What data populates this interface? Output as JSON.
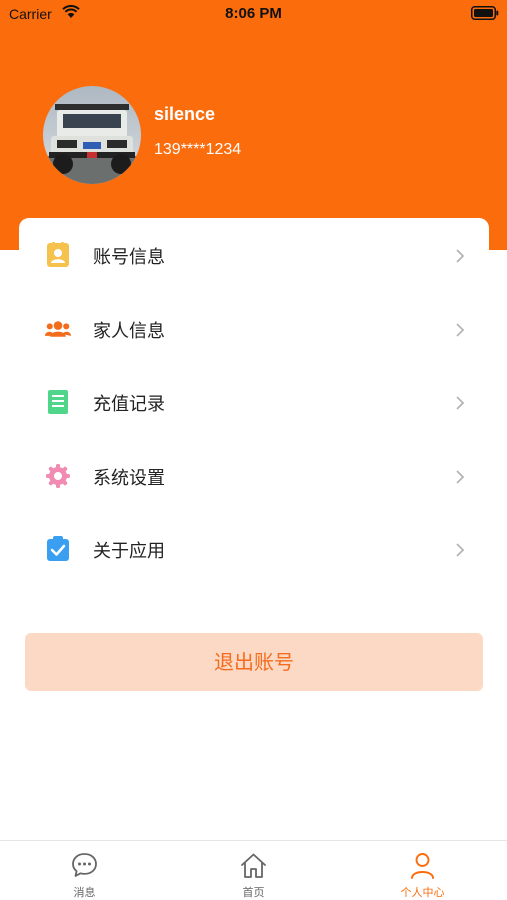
{
  "status_bar": {
    "carrier": "Carrier",
    "time": "8:06 PM"
  },
  "profile": {
    "name": "silence",
    "phone": "139****1234"
  },
  "menu": {
    "items": [
      {
        "label": "账号信息",
        "icon": "id-card-icon",
        "color": "#f4c24d"
      },
      {
        "label": "家人信息",
        "icon": "users-group-icon",
        "color": "#f36c1c"
      },
      {
        "label": "充值记录",
        "icon": "receipt-icon",
        "color": "#4fd68b"
      },
      {
        "label": "系统设置",
        "icon": "gear-icon",
        "color": "#f18bb3"
      },
      {
        "label": "关于应用",
        "icon": "clipboard-check-icon",
        "color": "#3a9ff0"
      }
    ]
  },
  "logout": {
    "label": "退出账号"
  },
  "tabbar": {
    "tabs": [
      {
        "label": "消息",
        "icon": "chat-bubble-icon"
      },
      {
        "label": "首页",
        "icon": "home-icon"
      },
      {
        "label": "个人中心",
        "icon": "person-icon",
        "active": true
      }
    ]
  },
  "colors": {
    "brand": "#fb6c0d",
    "logout_bg": "#fcd9c4",
    "logout_text": "#f56c1e"
  }
}
